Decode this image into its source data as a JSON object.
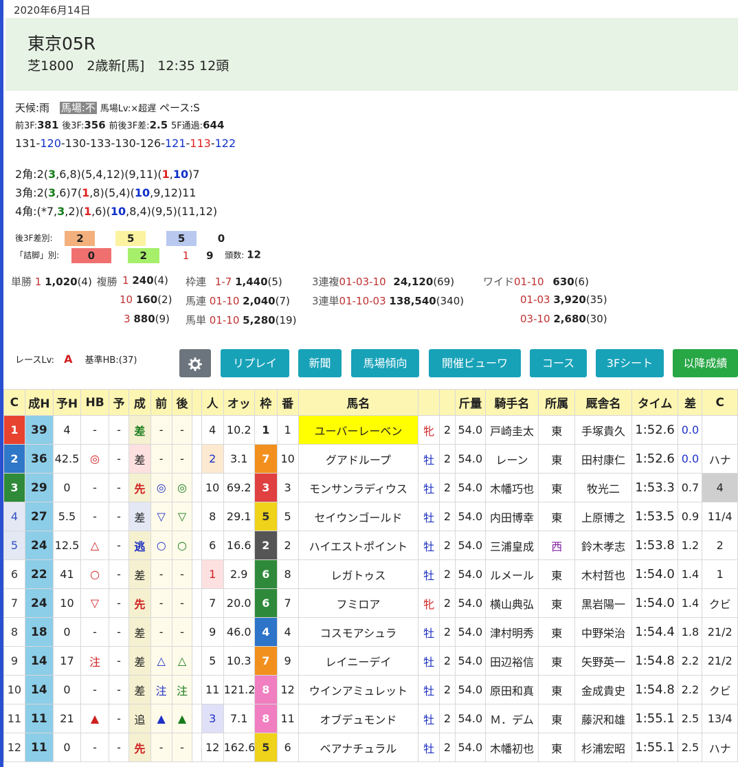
{
  "date": "2020年6月14日",
  "race": {
    "title": "東京05R",
    "subtitle": "芝1800　2歳新[馬]　12:35 12頭"
  },
  "conditions": {
    "weather": "天候:雨",
    "track": "馬場:不",
    "track_level": "馬場Lv:×超遅",
    "pace": "ペース:S",
    "f3_front_label": "前3F:",
    "f3_front": "381",
    "f3_back_label": "後3F:",
    "f3_back": "356",
    "f3_diff_label": "前後3F差:",
    "f3_diff": "2.5",
    "f5_label": "5F通過:",
    "f5": "644"
  },
  "laps": [
    "131",
    "120",
    "130",
    "133",
    "130",
    "126",
    "121",
    "113",
    "122"
  ],
  "lap_colors": [
    "k",
    "b",
    "k",
    "k",
    "k",
    "k",
    "b",
    "r",
    "b"
  ],
  "corners": {
    "c2": "2角:2(3,6,8)(5,4,12)(9,11)(1,10)7",
    "c3": "3角:2(3,6)7(1,8)(5,4)(10,9,12)11",
    "c4": "4角:(*7,3,2)(1,6)(10,8,4)(9,5)(11,12)"
  },
  "diffs": {
    "row1_label": "後3F差別:",
    "row1": [
      "2",
      "5",
      "5",
      "0"
    ],
    "row2_label": "「詰脚」別:",
    "row2": [
      "0",
      "2",
      "1",
      "9"
    ],
    "count_label": "頭数:",
    "count": "12"
  },
  "payouts": {
    "tansho_label": "単勝",
    "tansho_num": "1",
    "tansho": "1,020",
    "tansho_pop": "(4)",
    "fukusho_label": "複勝",
    "fukusho": [
      {
        "num": "1",
        "pay": "240",
        "pop": "(4)"
      },
      {
        "num": "10",
        "pay": "160",
        "pop": "(2)"
      },
      {
        "num": "3",
        "pay": "880",
        "pop": "(9)"
      }
    ],
    "wakuren_label": "枠連",
    "wakuren_num": "1-7",
    "wakuren": "1,440",
    "wakuren_pop": "(5)",
    "umaren_label": "馬連",
    "umaren_num": "01-10",
    "umaren": "2,040",
    "umaren_pop": "(7)",
    "umatan_label": "馬単",
    "umatan_num": "01-10",
    "umatan": "5,280",
    "umatan_pop": "(19)",
    "sanrenpuku_label": "3連複",
    "sanrenpuku_num": "01-03-10",
    "sanrenpuku": "24,120",
    "sanrenpuku_pop": "(69)",
    "sanrentan_label": "3連単",
    "sanrentan_num": "01-10-03",
    "sanrentan": "138,540",
    "sanrentan_pop": "(340)",
    "wide_label": "ワイド",
    "wide": [
      {
        "num": "01-10",
        "pay": "630",
        "pop": "(6)"
      },
      {
        "num": "01-03",
        "pay": "3,920",
        "pop": "(35)"
      },
      {
        "num": "03-10",
        "pay": "2,680",
        "pop": "(30)"
      }
    ]
  },
  "race_level_label": "レースLv:",
  "race_level": "A",
  "base_hb": "基準HB:(37)",
  "buttons": {
    "replay": "リプレイ",
    "news": "新聞",
    "trend": "馬場傾向",
    "viewer": "開催ビューワ",
    "course": "コース",
    "sheet": "3Fシート",
    "later": "以降成績"
  },
  "table": {
    "headers": [
      "C",
      "成H",
      "予H",
      "HB",
      "予",
      "成",
      "前",
      "後",
      "",
      "人",
      "オッ",
      "枠",
      "番",
      "馬名",
      "",
      "",
      "斤量",
      "騎手名",
      "所属",
      "厩舎名",
      "タイム",
      "差",
      "C"
    ],
    "rows": [
      {
        "rank": "1",
        "h": "39",
        "yh": "4",
        "hb": "-",
        "yo": "-",
        "pos": "差",
        "mae": "-",
        "ato": "-",
        "pop": "4",
        "odds": "10.2",
        "waku": "1",
        "num": "1",
        "name": "ユーバーレーベン",
        "sex": "牝",
        "age": "2",
        "kin": "54.0",
        "jockey": "戸崎圭太",
        "aff": "東",
        "trainer": "手塚貴久",
        "time": "1:52.6",
        "diff": "0.0",
        "margin": ""
      },
      {
        "rank": "2",
        "h": "36",
        "yh": "42.5",
        "hb": "◎",
        "yo": "-",
        "pos": "差",
        "mae": "-",
        "ato": "-",
        "pop": "2",
        "odds": "3.1",
        "waku": "7",
        "num": "10",
        "name": "グアドループ",
        "sex": "牡",
        "age": "2",
        "kin": "54.0",
        "jockey": "レーン",
        "aff": "東",
        "trainer": "田村康仁",
        "time": "1:52.6",
        "diff": "0.0",
        "margin": "ハナ"
      },
      {
        "rank": "3",
        "h": "29",
        "yh": "0",
        "hb": "-",
        "yo": "-",
        "pos": "先",
        "mae": "◎",
        "ato": "◎",
        "pop": "10",
        "odds": "69.2",
        "waku": "3",
        "num": "3",
        "name": "モンサンラディウス",
        "sex": "牡",
        "age": "2",
        "kin": "54.0",
        "jockey": "木幡巧也",
        "aff": "東",
        "trainer": "牧光二",
        "time": "1:53.3",
        "diff": "0.7",
        "margin": "4"
      },
      {
        "rank": "4",
        "h": "27",
        "yh": "5.5",
        "hb": "-",
        "yo": "-",
        "pos": "差",
        "mae": "▽",
        "ato": "▽",
        "pop": "8",
        "odds": "29.1",
        "waku": "5",
        "num": "5",
        "name": "セイウンゴールド",
        "sex": "牡",
        "age": "2",
        "kin": "54.0",
        "jockey": "内田博幸",
        "aff": "東",
        "trainer": "上原博之",
        "time": "1:53.5",
        "diff": "0.9",
        "margin": "11/4"
      },
      {
        "rank": "5",
        "h": "24",
        "yh": "12.5",
        "hb": "△",
        "yo": "-",
        "pos": "逃",
        "mae": "○",
        "ato": "○",
        "pop": "6",
        "odds": "16.6",
        "waku": "2",
        "num": "2",
        "name": "ハイエストポイント",
        "sex": "牡",
        "age": "2",
        "kin": "54.0",
        "jockey": "三浦皇成",
        "aff": "西",
        "trainer": "鈴木孝志",
        "time": "1:53.8",
        "diff": "1.2",
        "margin": "2"
      },
      {
        "rank": "6",
        "h": "22",
        "yh": "41",
        "hb": "○",
        "yo": "-",
        "pos": "差",
        "mae": "-",
        "ato": "-",
        "pop": "1",
        "odds": "2.9",
        "waku": "6",
        "num": "8",
        "name": "レガトゥス",
        "sex": "牡",
        "age": "2",
        "kin": "54.0",
        "jockey": "ルメール",
        "aff": "東",
        "trainer": "木村哲也",
        "time": "1:54.0",
        "diff": "1.4",
        "margin": "1"
      },
      {
        "rank": "7",
        "h": "24",
        "yh": "10",
        "hb": "▽",
        "yo": "-",
        "pos": "先",
        "mae": "-",
        "ato": "-",
        "pop": "7",
        "odds": "20.0",
        "waku": "6",
        "num": "7",
        "name": "フミロア",
        "sex": "牝",
        "age": "2",
        "kin": "54.0",
        "jockey": "横山典弘",
        "aff": "東",
        "trainer": "黒岩陽一",
        "time": "1:54.0",
        "diff": "1.4",
        "margin": "クビ"
      },
      {
        "rank": "8",
        "h": "18",
        "yh": "0",
        "hb": "-",
        "yo": "-",
        "pos": "差",
        "mae": "-",
        "ato": "-",
        "pop": "9",
        "odds": "46.0",
        "waku": "4",
        "num": "4",
        "name": "コスモアシュラ",
        "sex": "牡",
        "age": "2",
        "kin": "54.0",
        "jockey": "津村明秀",
        "aff": "東",
        "trainer": "中野栄治",
        "time": "1:54.4",
        "diff": "1.8",
        "margin": "21/2"
      },
      {
        "rank": "9",
        "h": "14",
        "yh": "17",
        "hb": "注",
        "yo": "-",
        "pos": "差",
        "mae": "△",
        "ato": "△",
        "pop": "5",
        "odds": "10.3",
        "waku": "7",
        "num": "9",
        "name": "レイニーデイ",
        "sex": "牡",
        "age": "2",
        "kin": "54.0",
        "jockey": "田辺裕信",
        "aff": "東",
        "trainer": "矢野英一",
        "time": "1:54.8",
        "diff": "2.2",
        "margin": "21/2"
      },
      {
        "rank": "10",
        "h": "14",
        "yh": "0",
        "hb": "-",
        "yo": "-",
        "pos": "差",
        "mae": "注",
        "ato": "注",
        "pop": "11",
        "odds": "121.2",
        "waku": "8",
        "num": "12",
        "name": "ウインアミュレット",
        "sex": "牡",
        "age": "2",
        "kin": "54.0",
        "jockey": "原田和真",
        "aff": "東",
        "trainer": "金成貴史",
        "time": "1:54.8",
        "diff": "2.2",
        "margin": "クビ"
      },
      {
        "rank": "11",
        "h": "11",
        "yh": "21",
        "hb": "▲",
        "yo": "-",
        "pos": "追",
        "mae": "▲",
        "ato": "▲",
        "pop": "3",
        "odds": "7.1",
        "waku": "8",
        "num": "11",
        "name": "オブデュモンド",
        "sex": "牡",
        "age": "2",
        "kin": "54.0",
        "jockey": "Ｍ．デム",
        "aff": "東",
        "trainer": "藤沢和雄",
        "time": "1:55.1",
        "diff": "2.5",
        "margin": "13/4"
      },
      {
        "rank": "12",
        "h": "11",
        "yh": "0",
        "hb": "-",
        "yo": "-",
        "pos": "先",
        "mae": "-",
        "ato": "-",
        "pop": "12",
        "odds": "162.6",
        "waku": "5",
        "num": "6",
        "name": "ベアナチュラル",
        "sex": "牡",
        "age": "2",
        "kin": "54.0",
        "jockey": "木幡初也",
        "aff": "東",
        "trainer": "杉浦宏昭",
        "time": "1:55.1",
        "diff": "2.5",
        "margin": "ハナ"
      }
    ]
  },
  "colors": {
    "header_bg": "#e7f3e4",
    "teal": "#18a2b8",
    "green": "#28a745",
    "gear": "#6c757d",
    "table_header": "#fdf6b3"
  }
}
